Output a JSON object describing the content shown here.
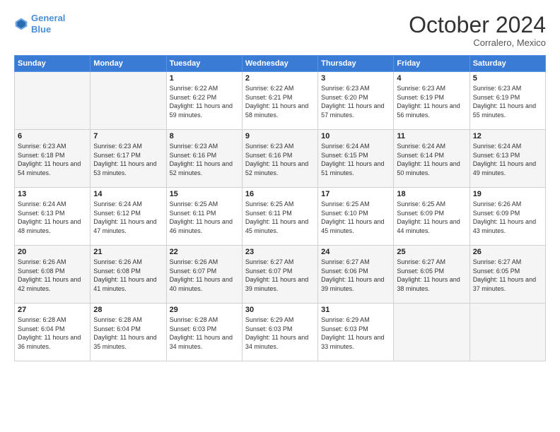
{
  "header": {
    "logo_line1": "General",
    "logo_line2": "Blue",
    "month": "October 2024",
    "location": "Corralero, Mexico"
  },
  "days_of_week": [
    "Sunday",
    "Monday",
    "Tuesday",
    "Wednesday",
    "Thursday",
    "Friday",
    "Saturday"
  ],
  "weeks": [
    [
      {
        "day": "",
        "sunrise": "",
        "sunset": "",
        "daylight": ""
      },
      {
        "day": "",
        "sunrise": "",
        "sunset": "",
        "daylight": ""
      },
      {
        "day": "1",
        "sunrise": "Sunrise: 6:22 AM",
        "sunset": "Sunset: 6:22 PM",
        "daylight": "Daylight: 11 hours and 59 minutes."
      },
      {
        "day": "2",
        "sunrise": "Sunrise: 6:22 AM",
        "sunset": "Sunset: 6:21 PM",
        "daylight": "Daylight: 11 hours and 58 minutes."
      },
      {
        "day": "3",
        "sunrise": "Sunrise: 6:23 AM",
        "sunset": "Sunset: 6:20 PM",
        "daylight": "Daylight: 11 hours and 57 minutes."
      },
      {
        "day": "4",
        "sunrise": "Sunrise: 6:23 AM",
        "sunset": "Sunset: 6:19 PM",
        "daylight": "Daylight: 11 hours and 56 minutes."
      },
      {
        "day": "5",
        "sunrise": "Sunrise: 6:23 AM",
        "sunset": "Sunset: 6:19 PM",
        "daylight": "Daylight: 11 hours and 55 minutes."
      }
    ],
    [
      {
        "day": "6",
        "sunrise": "Sunrise: 6:23 AM",
        "sunset": "Sunset: 6:18 PM",
        "daylight": "Daylight: 11 hours and 54 minutes."
      },
      {
        "day": "7",
        "sunrise": "Sunrise: 6:23 AM",
        "sunset": "Sunset: 6:17 PM",
        "daylight": "Daylight: 11 hours and 53 minutes."
      },
      {
        "day": "8",
        "sunrise": "Sunrise: 6:23 AM",
        "sunset": "Sunset: 6:16 PM",
        "daylight": "Daylight: 11 hours and 52 minutes."
      },
      {
        "day": "9",
        "sunrise": "Sunrise: 6:23 AM",
        "sunset": "Sunset: 6:16 PM",
        "daylight": "Daylight: 11 hours and 52 minutes."
      },
      {
        "day": "10",
        "sunrise": "Sunrise: 6:24 AM",
        "sunset": "Sunset: 6:15 PM",
        "daylight": "Daylight: 11 hours and 51 minutes."
      },
      {
        "day": "11",
        "sunrise": "Sunrise: 6:24 AM",
        "sunset": "Sunset: 6:14 PM",
        "daylight": "Daylight: 11 hours and 50 minutes."
      },
      {
        "day": "12",
        "sunrise": "Sunrise: 6:24 AM",
        "sunset": "Sunset: 6:13 PM",
        "daylight": "Daylight: 11 hours and 49 minutes."
      }
    ],
    [
      {
        "day": "13",
        "sunrise": "Sunrise: 6:24 AM",
        "sunset": "Sunset: 6:13 PM",
        "daylight": "Daylight: 11 hours and 48 minutes."
      },
      {
        "day": "14",
        "sunrise": "Sunrise: 6:24 AM",
        "sunset": "Sunset: 6:12 PM",
        "daylight": "Daylight: 11 hours and 47 minutes."
      },
      {
        "day": "15",
        "sunrise": "Sunrise: 6:25 AM",
        "sunset": "Sunset: 6:11 PM",
        "daylight": "Daylight: 11 hours and 46 minutes."
      },
      {
        "day": "16",
        "sunrise": "Sunrise: 6:25 AM",
        "sunset": "Sunset: 6:11 PM",
        "daylight": "Daylight: 11 hours and 45 minutes."
      },
      {
        "day": "17",
        "sunrise": "Sunrise: 6:25 AM",
        "sunset": "Sunset: 6:10 PM",
        "daylight": "Daylight: 11 hours and 45 minutes."
      },
      {
        "day": "18",
        "sunrise": "Sunrise: 6:25 AM",
        "sunset": "Sunset: 6:09 PM",
        "daylight": "Daylight: 11 hours and 44 minutes."
      },
      {
        "day": "19",
        "sunrise": "Sunrise: 6:26 AM",
        "sunset": "Sunset: 6:09 PM",
        "daylight": "Daylight: 11 hours and 43 minutes."
      }
    ],
    [
      {
        "day": "20",
        "sunrise": "Sunrise: 6:26 AM",
        "sunset": "Sunset: 6:08 PM",
        "daylight": "Daylight: 11 hours and 42 minutes."
      },
      {
        "day": "21",
        "sunrise": "Sunrise: 6:26 AM",
        "sunset": "Sunset: 6:08 PM",
        "daylight": "Daylight: 11 hours and 41 minutes."
      },
      {
        "day": "22",
        "sunrise": "Sunrise: 6:26 AM",
        "sunset": "Sunset: 6:07 PM",
        "daylight": "Daylight: 11 hours and 40 minutes."
      },
      {
        "day": "23",
        "sunrise": "Sunrise: 6:27 AM",
        "sunset": "Sunset: 6:07 PM",
        "daylight": "Daylight: 11 hours and 39 minutes."
      },
      {
        "day": "24",
        "sunrise": "Sunrise: 6:27 AM",
        "sunset": "Sunset: 6:06 PM",
        "daylight": "Daylight: 11 hours and 39 minutes."
      },
      {
        "day": "25",
        "sunrise": "Sunrise: 6:27 AM",
        "sunset": "Sunset: 6:05 PM",
        "daylight": "Daylight: 11 hours and 38 minutes."
      },
      {
        "day": "26",
        "sunrise": "Sunrise: 6:27 AM",
        "sunset": "Sunset: 6:05 PM",
        "daylight": "Daylight: 11 hours and 37 minutes."
      }
    ],
    [
      {
        "day": "27",
        "sunrise": "Sunrise: 6:28 AM",
        "sunset": "Sunset: 6:04 PM",
        "daylight": "Daylight: 11 hours and 36 minutes."
      },
      {
        "day": "28",
        "sunrise": "Sunrise: 6:28 AM",
        "sunset": "Sunset: 6:04 PM",
        "daylight": "Daylight: 11 hours and 35 minutes."
      },
      {
        "day": "29",
        "sunrise": "Sunrise: 6:28 AM",
        "sunset": "Sunset: 6:03 PM",
        "daylight": "Daylight: 11 hours and 34 minutes."
      },
      {
        "day": "30",
        "sunrise": "Sunrise: 6:29 AM",
        "sunset": "Sunset: 6:03 PM",
        "daylight": "Daylight: 11 hours and 34 minutes."
      },
      {
        "day": "31",
        "sunrise": "Sunrise: 6:29 AM",
        "sunset": "Sunset: 6:03 PM",
        "daylight": "Daylight: 11 hours and 33 minutes."
      },
      {
        "day": "",
        "sunrise": "",
        "sunset": "",
        "daylight": ""
      },
      {
        "day": "",
        "sunrise": "",
        "sunset": "",
        "daylight": ""
      }
    ]
  ]
}
